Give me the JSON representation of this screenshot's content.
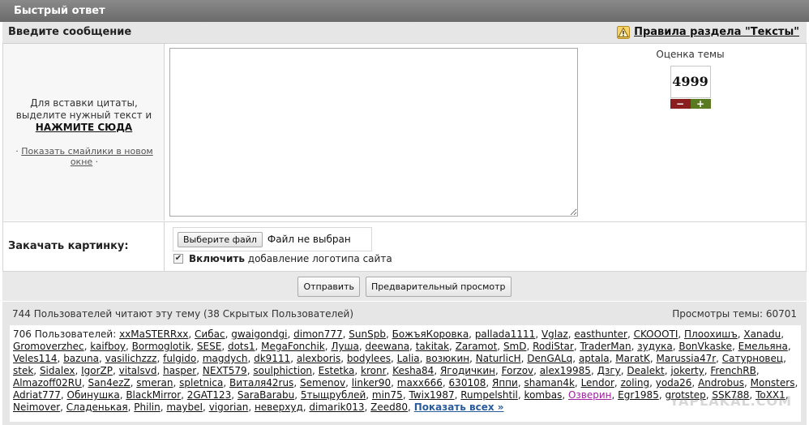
{
  "titlebar": {
    "title": "Быстрый ответ"
  },
  "subheader": {
    "prompt": "Введите сообщение",
    "rules_link": "Правила раздела \"Тексты\""
  },
  "quote_hint": {
    "line1": "Для вставки цитаты,",
    "line2": "выделите нужный текст и",
    "action": "НАЖМИТЕ СЮДА"
  },
  "smiles": {
    "prefix": "·",
    "link": "Показать смайлики в новом окне",
    "suffix": "·"
  },
  "message": {
    "value": "",
    "placeholder": ""
  },
  "rating": {
    "label": "Оценка темы",
    "value": "4999",
    "minus": "−",
    "plus": "+"
  },
  "upload": {
    "label": "Закачать картинку:",
    "choose_button": "Выберите файл",
    "no_file": "Файл не выбран",
    "logo_bold": "Включить",
    "logo_text": "добавление логотипа сайта",
    "logo_checked": true
  },
  "actions": {
    "send": "Отправить",
    "preview": "Предварительный просмотр"
  },
  "stats": {
    "readers": "744 Пользователей читают эту тему (38 Скрытых Пользователей)",
    "views": "Просмотры темы: 60701",
    "users_label": "706 Пользователей:",
    "show_all": "Показать всех »",
    "users": [
      "xxMaSTERRxx",
      "Сибас",
      "gwaigondgi",
      "dimon777",
      "SunSpb",
      "БожъяКоровка",
      "pallada1111",
      "Vglaz",
      "easthunter",
      "CKOOOTI",
      "Плоохишъ",
      "Xanadu",
      "Gromoverzhec",
      "kaifboy",
      "Bormoglotik",
      "SESE",
      "dots1",
      "MegaFonchik",
      "Луша",
      "deewana",
      "takitak",
      "Zaramot",
      "SmD",
      "RodiStar",
      "TraderMan",
      "зудука",
      "BonVkaske",
      "Емельяна",
      "Veles114",
      "bazuna",
      "vasilichzzz",
      "fulgido",
      "magdych",
      "dk9111",
      "alexboris",
      "bodylees",
      "Lalia",
      "возюкин",
      "NaturlicH",
      "DenGALq",
      "aptala",
      "MaratK",
      "Marussia47r",
      "Сатурновец",
      "stek",
      "Sidalex",
      "IgorZP",
      "vitalsvd",
      "hasper",
      "NEXT579",
      "soulphiction",
      "Estetka",
      "kronr",
      "Kesha84",
      "Ягодичкин",
      "Forzov",
      "alex19985",
      "Дзгу",
      "Dealekt",
      "jokerty",
      "FrenchRB",
      "Almazoff02RU",
      "San4ezZ",
      "smeran",
      "spletnica",
      "Виталя42rus",
      "Semenov",
      "linker90",
      "maxx666",
      "630108",
      "Яппи",
      "shaman4k",
      "Lendor",
      "zoling",
      "yoda26",
      "Androbus",
      "Monsters",
      "Adriat777",
      "Обинушка",
      "BlackMirror",
      "2GAT123",
      "SaraBarabu",
      "5тыщрублей",
      "min75",
      "Twix1987",
      "Rumpelshtil",
      "kombas",
      "Озверин",
      "Egr1985",
      "grotstep",
      "SSK788",
      "ToXX1",
      "Neimover",
      "Сладенькая",
      "Philin",
      "maybeI",
      "vigorian",
      "неверхуд",
      "dimarik013",
      "Zeed80"
    ],
    "violet_user": "Озверин"
  },
  "watermark": "YAPLAKAL.COM",
  "colors": {
    "title_bg": "#7a7a7a",
    "minus": "#8b1f1f",
    "plus": "#5a7a22",
    "link_blue": "#2a5b9c"
  }
}
